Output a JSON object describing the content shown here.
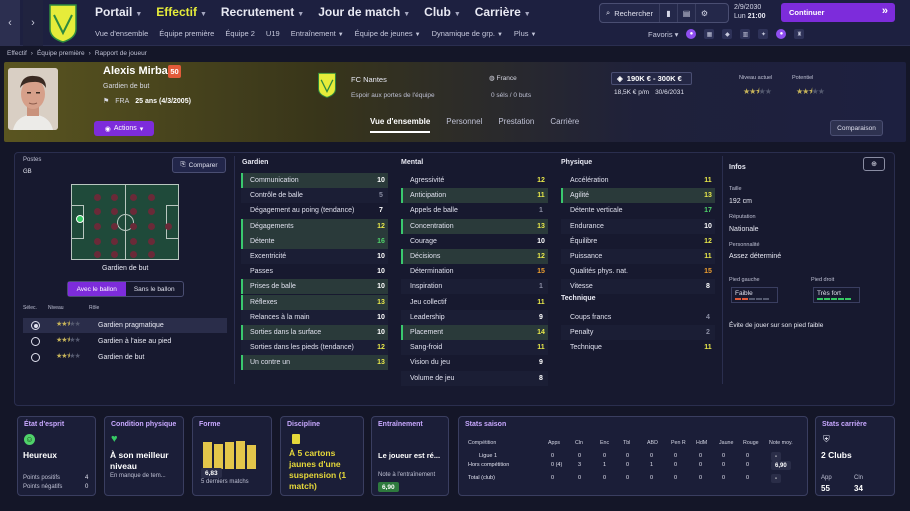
{
  "nav": {
    "back": "‹",
    "forward": "›",
    "menu": [
      {
        "label": "Portail",
        "active": false
      },
      {
        "label": "Effectif",
        "active": true
      },
      {
        "label": "Recrutement",
        "active": false
      },
      {
        "label": "Jour de match",
        "active": false
      },
      {
        "label": "Club",
        "active": false
      },
      {
        "label": "Carrière",
        "active": false
      }
    ],
    "submenu": [
      "Vue d'ensemble",
      "Équipe première",
      "Équipe 2",
      "U19",
      "Entraînement",
      "Équipe de jeunes",
      "Dynamique de grp.",
      "Plus"
    ],
    "search_label": "Rechercher",
    "date": "2/9/2030",
    "day": "Lun",
    "time": "21:00",
    "continue_label": "Continuer",
    "favorites_label": "Favoris"
  },
  "breadcrumb": [
    "Effectif",
    "Équipe première",
    "Rapport de joueur"
  ],
  "player": {
    "name": "Alexis Mirbach",
    "ca": "50",
    "position": "Gardien de but",
    "nationality": "FRA",
    "age": "25 ans (4/3/2005)",
    "actions_label": "Actions",
    "club": "FC Nantes",
    "club_status": "Espoir aux portes de l'équipe",
    "country": "France",
    "caps": "0 séls / 0 buts",
    "value": "190K € - 300K €",
    "wage": "18,5K € p/m",
    "contract_end": "30/6/2031",
    "current_level_label": "Niveau actuel",
    "potential_label": "Potentiel",
    "current_stars": 2.5,
    "potential_stars": 2.5
  },
  "tabs": [
    "Vue d'ensemble",
    "Personnel",
    "Prestation",
    "Carrière"
  ],
  "comparison_label": "Comparaison",
  "positions": {
    "title": "Postes",
    "value": "GB",
    "compare_label": "Comparer",
    "pitch_caption": "Gardien de but",
    "toggle": [
      "Avec le ballon",
      "Sans le ballon"
    ],
    "headers": [
      "Sélec.",
      "Niveau",
      "Rôle"
    ],
    "roles": [
      {
        "name": "Gardien pragmatique",
        "stars": 2.5,
        "selected": true
      },
      {
        "name": "Gardien à l'aise au pied",
        "stars": 2.5,
        "selected": false
      },
      {
        "name": "Gardien de but",
        "stars": 2.5,
        "selected": false
      }
    ]
  },
  "attributes": {
    "gardien_title": "Gardien",
    "mental_title": "Mental",
    "physique_title": "Physique",
    "technique_title": "Technique",
    "gardien": [
      {
        "name": "Communication",
        "value": "10",
        "c": "w",
        "hl": true
      },
      {
        "name": "Contrôle de balle",
        "value": "5",
        "c": "d"
      },
      {
        "name": "Dégagement au poing (tendance)",
        "value": "7",
        "c": "w"
      },
      {
        "name": "Dégagements",
        "value": "12",
        "c": "y",
        "hl": true
      },
      {
        "name": "Détente",
        "value": "16",
        "c": "g",
        "hl": true
      },
      {
        "name": "Excentricité",
        "value": "10",
        "c": "w"
      },
      {
        "name": "Passes",
        "value": "10",
        "c": "w"
      },
      {
        "name": "Prises de balle",
        "value": "10",
        "c": "w",
        "hl": true
      },
      {
        "name": "Réflexes",
        "value": "13",
        "c": "y",
        "hl": true
      },
      {
        "name": "Relances à la main",
        "value": "10",
        "c": "w"
      },
      {
        "name": "Sorties dans la surface",
        "value": "10",
        "c": "w",
        "hl": true
      },
      {
        "name": "Sorties dans les pieds (tendance)",
        "value": "12",
        "c": "y"
      },
      {
        "name": "Un contre un",
        "value": "13",
        "c": "y",
        "hl": true
      }
    ],
    "mental": [
      {
        "name": "Agressivité",
        "value": "12",
        "c": "y"
      },
      {
        "name": "Anticipation",
        "value": "11",
        "c": "y",
        "hl": true
      },
      {
        "name": "Appels de balle",
        "value": "1",
        "c": "d"
      },
      {
        "name": "Concentration",
        "value": "13",
        "c": "y",
        "hl": true
      },
      {
        "name": "Courage",
        "value": "10",
        "c": "w"
      },
      {
        "name": "Décisions",
        "value": "12",
        "c": "y",
        "hl": true
      },
      {
        "name": "Détermination",
        "value": "15",
        "c": "o"
      },
      {
        "name": "Inspiration",
        "value": "1",
        "c": "d"
      },
      {
        "name": "Jeu collectif",
        "value": "11",
        "c": "y"
      },
      {
        "name": "Leadership",
        "value": "9",
        "c": "w"
      },
      {
        "name": "Placement",
        "value": "14",
        "c": "y",
        "hl": true
      },
      {
        "name": "Sang-froid",
        "value": "11",
        "c": "y"
      },
      {
        "name": "Vision du jeu",
        "value": "9",
        "c": "w"
      },
      {
        "name": "Volume de jeu",
        "value": "8",
        "c": "w"
      }
    ],
    "physique": [
      {
        "name": "Accélération",
        "value": "11",
        "c": "y"
      },
      {
        "name": "Agilité",
        "value": "13",
        "c": "y",
        "hl": true
      },
      {
        "name": "Détente verticale",
        "value": "17",
        "c": "g"
      },
      {
        "name": "Endurance",
        "value": "10",
        "c": "w"
      },
      {
        "name": "Équilibre",
        "value": "12",
        "c": "y"
      },
      {
        "name": "Puissance",
        "value": "11",
        "c": "y"
      },
      {
        "name": "Qualités phys. nat.",
        "value": "15",
        "c": "o"
      },
      {
        "name": "Vitesse",
        "value": "8",
        "c": "w"
      }
    ],
    "technique": [
      {
        "name": "Coups francs",
        "value": "4",
        "c": "d"
      },
      {
        "name": "Penalty",
        "value": "2",
        "c": "d"
      },
      {
        "name": "Technique",
        "value": "11",
        "c": "y"
      }
    ]
  },
  "info": {
    "title": "Infos",
    "height_label": "Taille",
    "height": "192 cm",
    "reputation_label": "Réputation",
    "reputation": "Nationale",
    "personality_label": "Personnalité",
    "personality": "Assez déterminé",
    "left_foot_label": "Pied gauche",
    "left_foot": "Faible",
    "right_foot_label": "Pied droit",
    "right_foot": "Très fort",
    "note": "Évite de jouer sur son pied faible"
  },
  "cards": {
    "etat": {
      "title": "État d'esprit",
      "value": "Heureux",
      "pos_label": "Points positifs",
      "pos": "4",
      "neg_label": "Points négatifs",
      "neg": "0"
    },
    "condition": {
      "title": "Condition physique",
      "value": "À son meilleur niveau",
      "sub": "En manque de tem..."
    },
    "forme": {
      "title": "Forme",
      "avg": "6,83",
      "sub": "5 derniers matchs",
      "bars": [
        0.78,
        0.74,
        0.78,
        0.82,
        0.7
      ]
    },
    "discipline": {
      "title": "Discipline",
      "value": "À 5 cartons jaunes d'une suspension (1 match)"
    },
    "entrainement": {
      "title": "Entraînement",
      "value": "Le joueur est ré...",
      "note_label": "Note à l'entraînement",
      "note": "6,90"
    },
    "saison": {
      "title": "Stats saison",
      "headers": [
        "Compétition",
        "Apps",
        "Cln",
        "Enc",
        "Tbl",
        "ABD",
        "Pen R",
        "HdM",
        "Jaune",
        "Rouge",
        "Note moy."
      ],
      "rows": [
        {
          "comp": "Ligue 1",
          "vals": [
            "0",
            "0",
            "0",
            "0",
            "0",
            "0",
            "0",
            "0",
            "0"
          ],
          "note": "-"
        },
        {
          "comp": "Hors compétition",
          "vals": [
            "0 (4)",
            "3",
            "1",
            "0",
            "1",
            "0",
            "0",
            "0",
            "0"
          ],
          "note": "6,90"
        },
        {
          "comp": "Total (club)",
          "vals": [
            "0",
            "0",
            "0",
            "0",
            "0",
            "0",
            "0",
            "0",
            "0"
          ],
          "note": "-"
        }
      ]
    },
    "carriere": {
      "title": "Stats carrière",
      "value": "2 Clubs",
      "app_label": "App",
      "app": "55",
      "cln_label": "Cln",
      "cln": "34"
    }
  },
  "colors": {
    "accent": "#7d2cdb",
    "club_yellow": "#e6ec3a",
    "good": "#4fd26a"
  }
}
